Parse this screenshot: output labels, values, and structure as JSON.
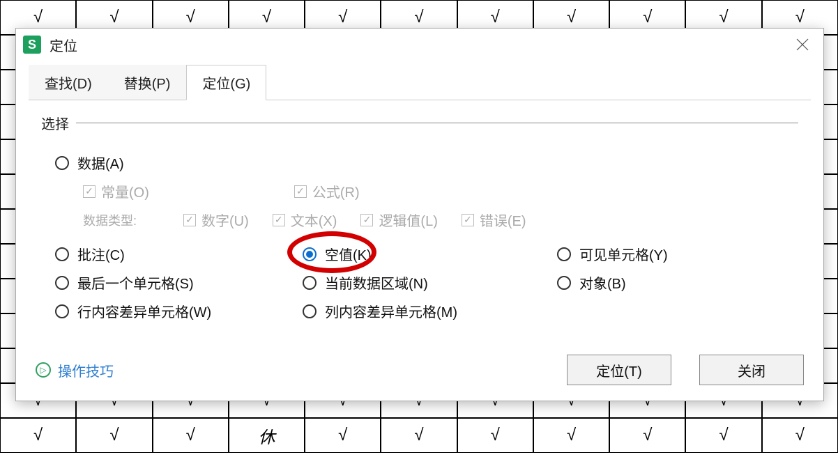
{
  "dialog": {
    "title": "定位",
    "tabs": {
      "find": "查找(D)",
      "replace": "替换(P)",
      "goto": "定位(G)"
    },
    "section_label": "选择",
    "options": {
      "data": "数据(A)",
      "constants": "常量(O)",
      "formulas": "公式(R)",
      "datatype_label": "数据类型:",
      "numbers": "数字(U)",
      "text": "文本(X)",
      "logical": "逻辑值(L)",
      "errors": "错误(E)",
      "comments": "批注(C)",
      "blanks": "空值(K)",
      "visible": "可见单元格(Y)",
      "lastcell": "最后一个单元格(S)",
      "curregion": "当前数据区域(N)",
      "objects": "对象(B)",
      "rowdiff": "行内容差异单元格(W)",
      "coldiff": "列内容差异单元格(M)"
    },
    "selected_option": "blanks",
    "tips_link": "操作技巧",
    "buttons": {
      "goto": "定位(T)",
      "close": "关闭"
    }
  },
  "background": {
    "cell_mark": "√",
    "special_cell": "休"
  }
}
